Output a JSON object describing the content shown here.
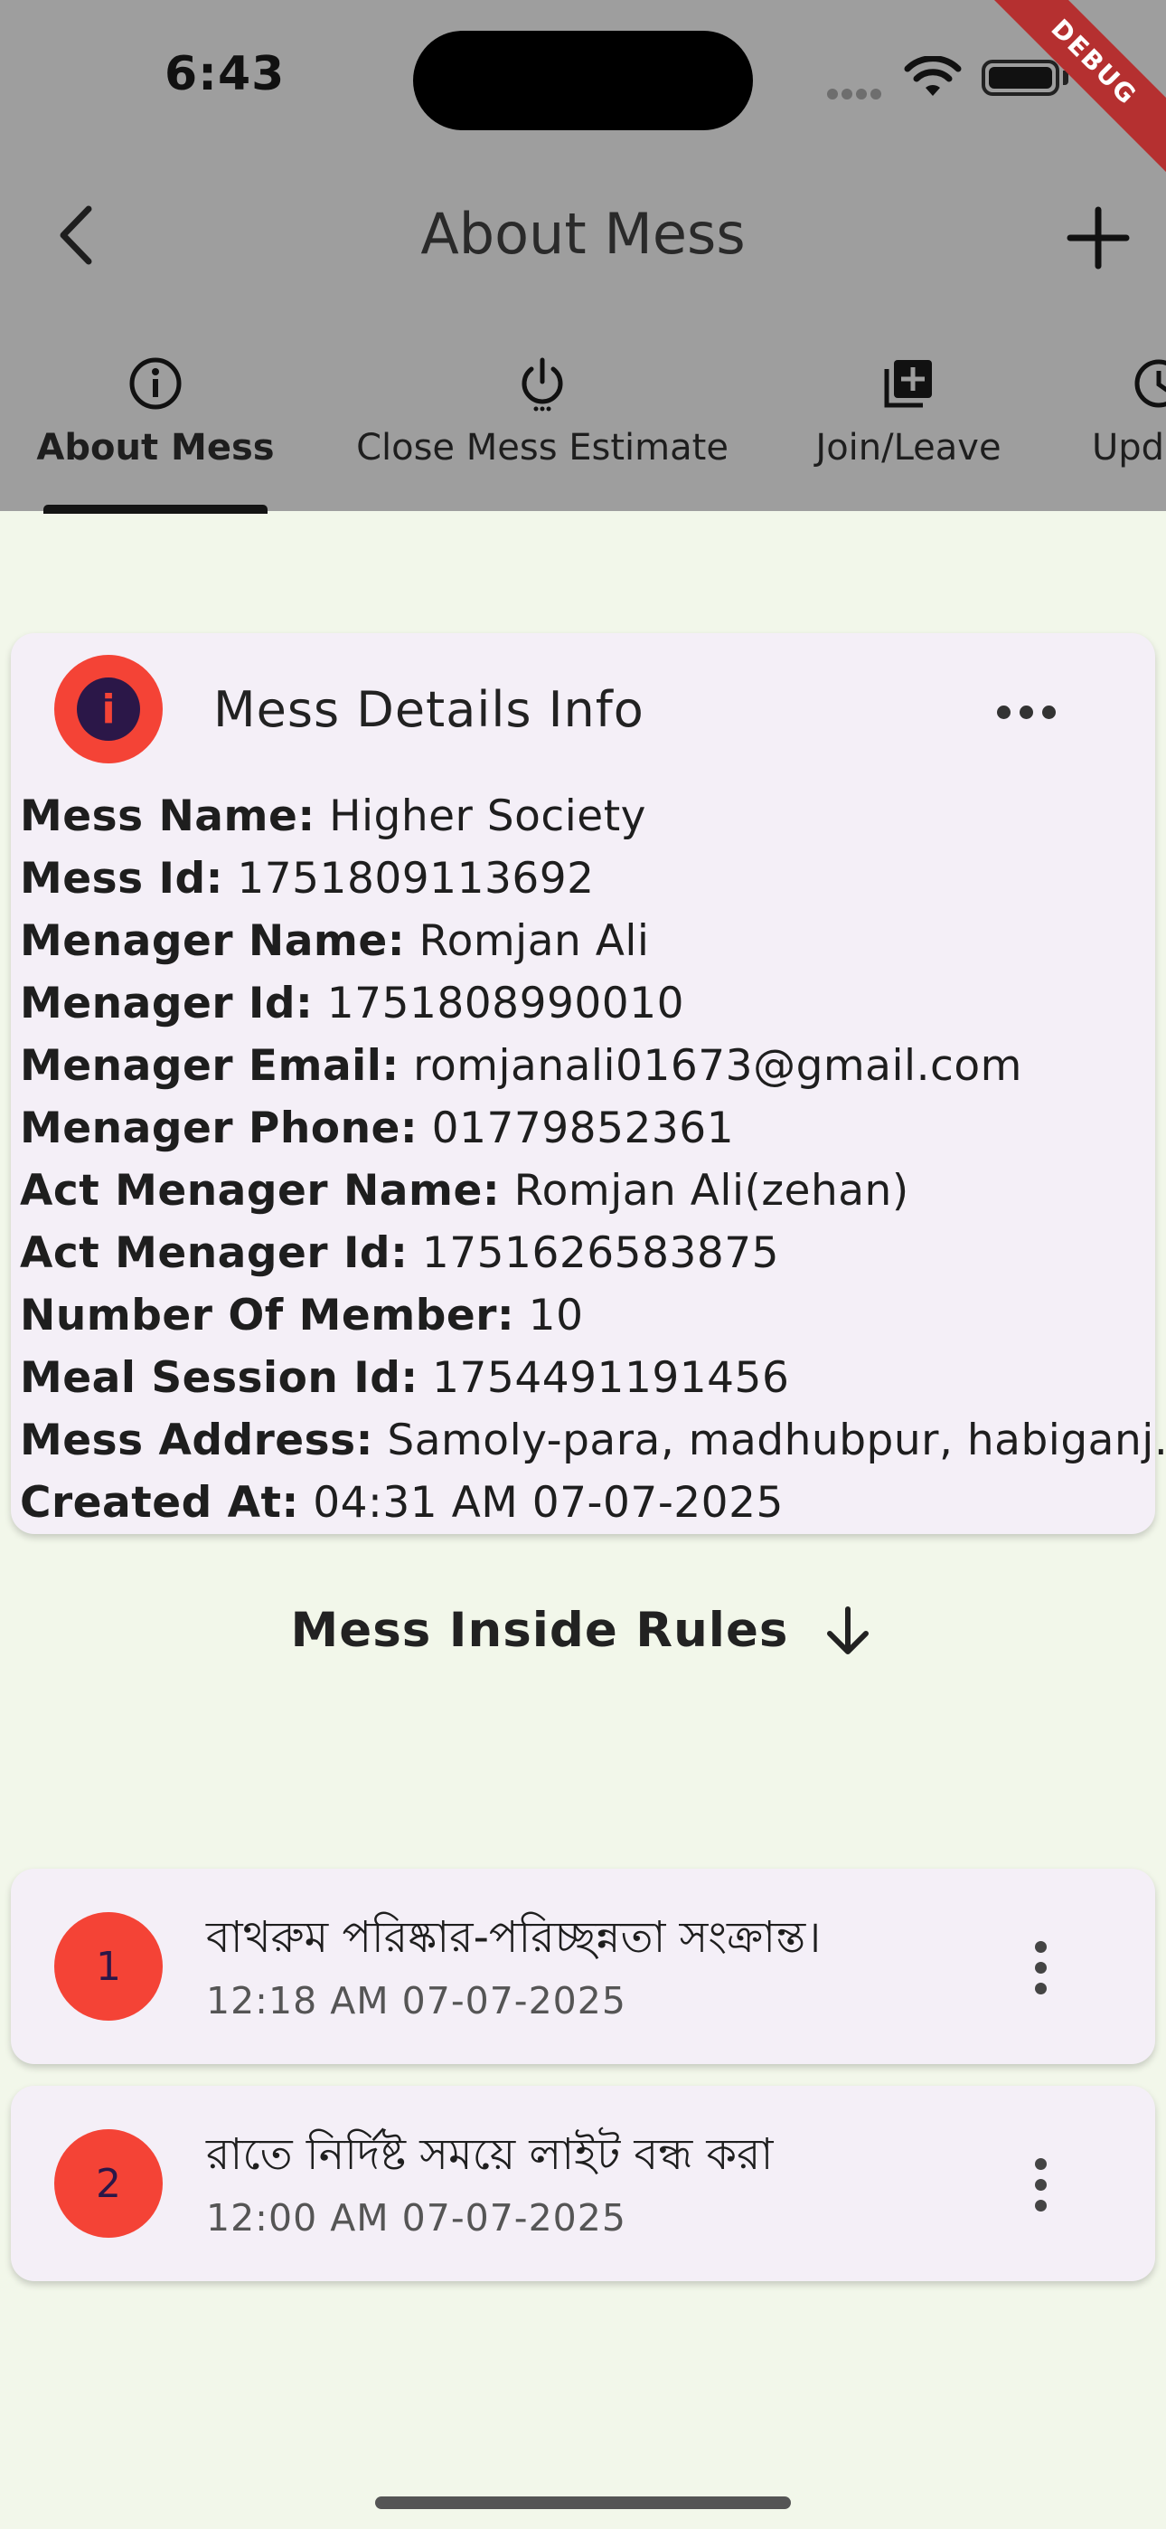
{
  "status_bar": {
    "time": "6:43"
  },
  "debug_banner": "DEBUG",
  "app_bar": {
    "title": "About Mess"
  },
  "tabs": [
    {
      "label": "About Mess",
      "icon": "info-circle-icon",
      "active": true
    },
    {
      "label": "Close Mess Estimate",
      "icon": "power-icon",
      "active": false
    },
    {
      "label": "Join/Leave",
      "icon": "library-add-icon",
      "active": false
    },
    {
      "label": "Upd",
      "icon": "update-icon",
      "active": false
    }
  ],
  "details_card": {
    "title": "Mess Details Info",
    "rows": [
      {
        "label": "Mess Name:",
        "value": "Higher Society"
      },
      {
        "label": "Mess Id:",
        "value": "1751809113692"
      },
      {
        "label": "Menager Name:",
        "value": "Romjan Ali"
      },
      {
        "label": "Menager Id:",
        "value": "1751808990010"
      },
      {
        "label": "Menager Email:",
        "value": "romjanali01673@gmail.com"
      },
      {
        "label": "Menager Phone:",
        "value": "01779852361"
      },
      {
        "label": "Act Menager Name:",
        "value": "Romjan Ali(zehan)"
      },
      {
        "label": "Act Menager Id:",
        "value": "1751626583875"
      },
      {
        "label": "Number Of Member:",
        "value": "10"
      },
      {
        "label": "Meal Session Id:",
        "value": "1754491191456"
      },
      {
        "label": "Mess Address:",
        "value": "Samoly-para, madhubpur, habiganj."
      },
      {
        "label": "Created At:",
        "value": "04:31 AM 07-07-2025"
      }
    ]
  },
  "rules_section": {
    "title": "Mess Inside Rules"
  },
  "rules": [
    {
      "number": "1",
      "title": "বাথরুম পরিষ্কার-পরিচ্ছন্নতা সংক্রান্ত।",
      "time": "12:18 AM 07-07-2025"
    },
    {
      "number": "2",
      "title": "রাতে নির্দিষ্ট সময়ে লাইট বন্ধ করা",
      "time": "12:00 AM 07-07-2025"
    }
  ],
  "colors": {
    "accent": "#F44336",
    "background": "#F2F7EA",
    "card": "#F4EFF7",
    "header_scrim": "#9E9E9E"
  }
}
